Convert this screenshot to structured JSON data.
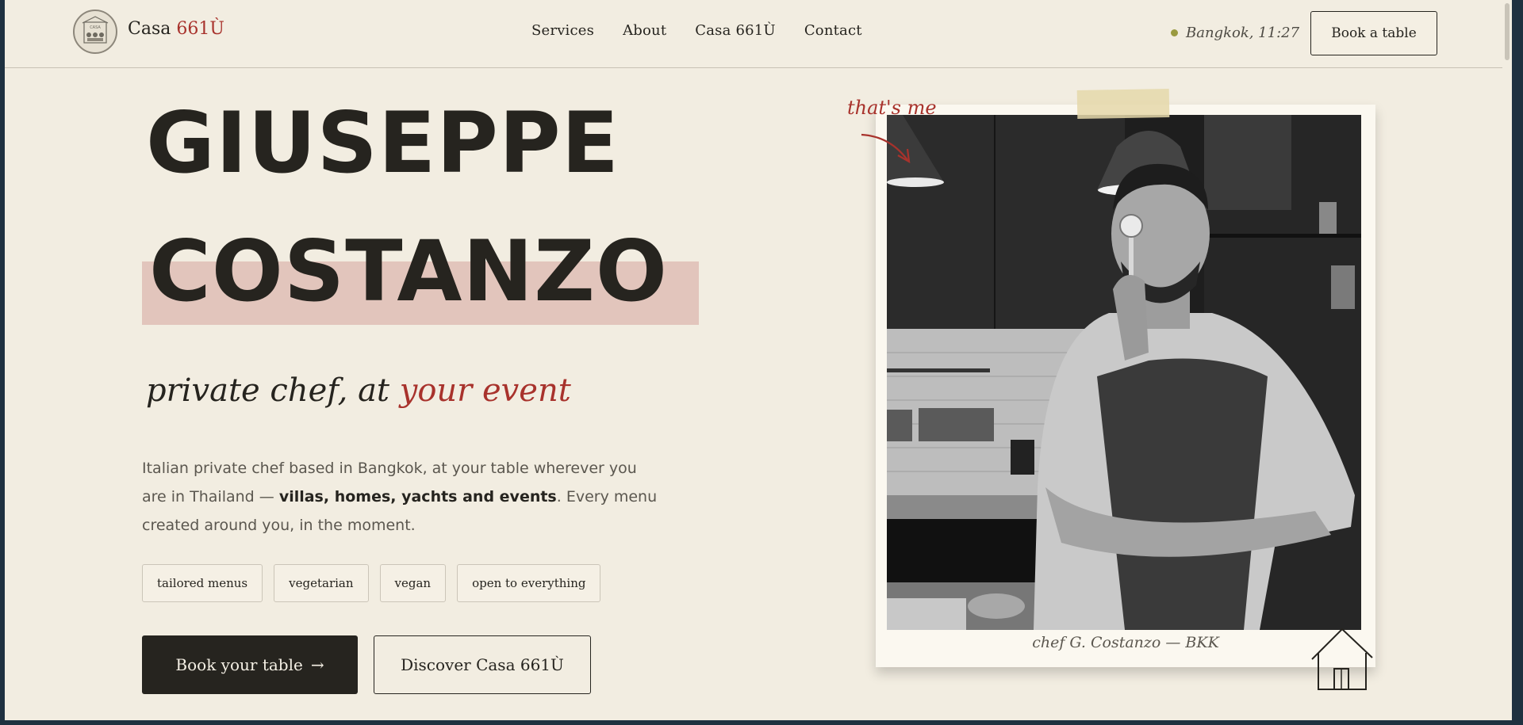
{
  "header": {
    "brand_prefix": "Casa ",
    "brand_suffix": "661Ù",
    "nav": [
      "Services",
      "About",
      "Casa 661Ù",
      "Contact"
    ],
    "status": "Bangkok,  11:27",
    "book_button": "Book a table"
  },
  "hero": {
    "name_line1": "GIUSEPPE",
    "name_line2": "COSTANZO",
    "tagline_part1": "private chef, at ",
    "tagline_part2": "your event",
    "desc_part1": "Italian private chef based in Bangkok, at your table wherever you are in Thailand — ",
    "desc_bold": "villas, homes, yachts and events",
    "desc_part2": ". Every menu created around you, in the moment.",
    "tags": [
      "tailored menus",
      "vegetarian",
      "vegan",
      "open to everything"
    ],
    "cta_primary": "Book your table",
    "cta_primary_arrow": "→",
    "cta_secondary": "Discover Casa 661Ù"
  },
  "photo": {
    "annotation": "that's me",
    "caption": "chef G. Costanzo — BKK"
  },
  "colors": {
    "background": "#f2ede1",
    "ink": "#26241f",
    "accent_red": "#a8322c",
    "highlight": "#e2c5bc",
    "status_dot": "#9a9a40"
  },
  "icons": [
    "logo-emblem",
    "arrow-right-icon",
    "curved-arrow-icon",
    "house-doodle-icon",
    "status-dot-icon"
  ]
}
